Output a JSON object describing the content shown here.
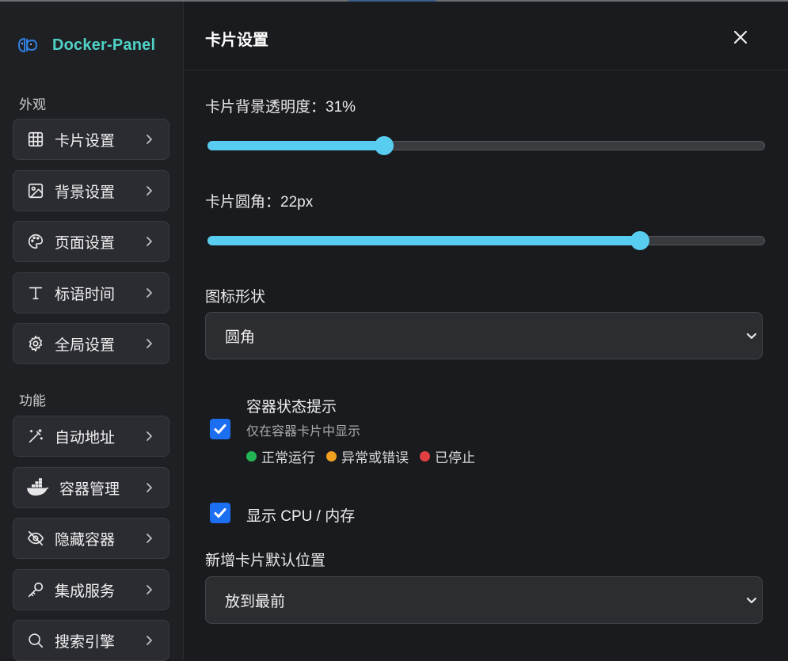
{
  "app": {
    "title": "Docker-Panel"
  },
  "colors": {
    "accent": "#58cdf0",
    "brand": "#4fd1c5",
    "checkbox": "#1d6ff2"
  },
  "sidebar": {
    "sections": [
      {
        "label": "外观"
      },
      {
        "label": "功能"
      }
    ],
    "items": [
      {
        "label": "卡片设置",
        "icon": "grid-icon"
      },
      {
        "label": "背景设置",
        "icon": "image-icon"
      },
      {
        "label": "页面设置",
        "icon": "palette-icon"
      },
      {
        "label": "标语时间",
        "icon": "type-icon"
      },
      {
        "label": "全局设置",
        "icon": "gear-icon"
      },
      {
        "label": "自动地址",
        "icon": "magic-wand-icon"
      },
      {
        "label": "容器管理",
        "icon": "docker-whale-icon"
      },
      {
        "label": "隐藏容器",
        "icon": "eye-off-icon"
      },
      {
        "label": "集成服务",
        "icon": "key-icon"
      },
      {
        "label": "搜索引擎",
        "icon": "search-icon"
      }
    ]
  },
  "panel": {
    "title": "卡片设置",
    "opacity": {
      "label": "卡片背景透明度：31%",
      "value": 31,
      "min": 0,
      "max": 100
    },
    "radius": {
      "label": "卡片圆角：22px",
      "value": 22,
      "min": 0,
      "max": 28
    },
    "icon_shape": {
      "label": "图标形状",
      "value": "圆角"
    },
    "status_hint": {
      "checked": true,
      "title": "容器状态提示",
      "subtitle": "仅在容器卡片中显示",
      "legend": [
        {
          "label": "正常运行",
          "color": "#22b455"
        },
        {
          "label": "异常或错误",
          "color": "#f0a020"
        },
        {
          "label": "已停止",
          "color": "#e04040"
        }
      ]
    },
    "show_cpu": {
      "checked": true,
      "label": "显示 CPU / 内存"
    },
    "new_card_position": {
      "label": "新增卡片默认位置",
      "value": "放到最前"
    }
  }
}
